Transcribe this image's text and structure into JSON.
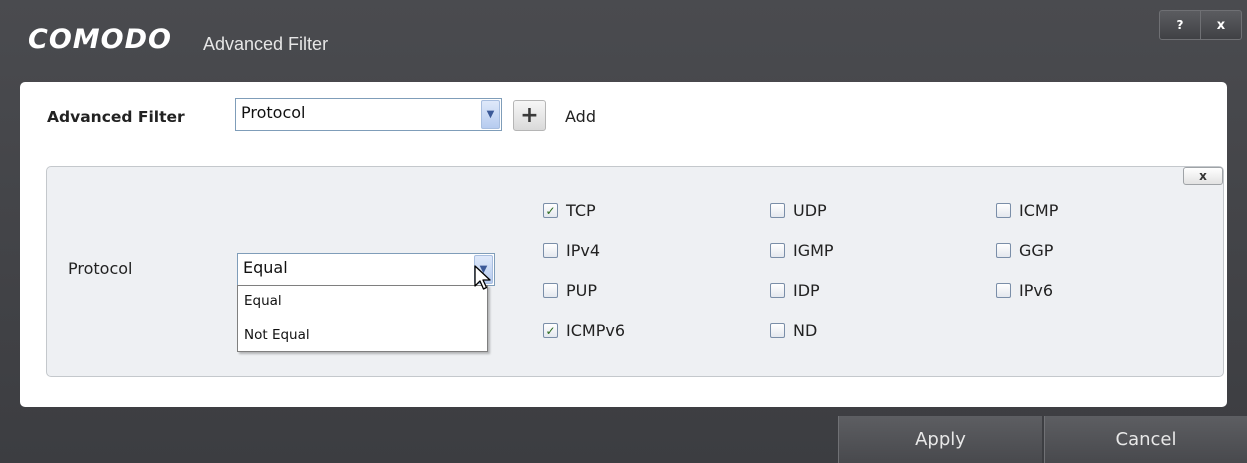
{
  "window": {
    "brand": "COMODO",
    "title": "Advanced Filter",
    "help_label": "?",
    "close_label": "x"
  },
  "filter": {
    "label": "Advanced Filter",
    "selected": "Protocol",
    "add_label": "Add"
  },
  "panel": {
    "remove_label": "x",
    "row_label": "Protocol",
    "operator": {
      "selected": "Equal",
      "options": [
        "Equal",
        "Not Equal"
      ]
    },
    "protocols": [
      {
        "label": "TCP",
        "checked": true
      },
      {
        "label": "UDP",
        "checked": false
      },
      {
        "label": "ICMP",
        "checked": false
      },
      {
        "label": "IPv4",
        "checked": false
      },
      {
        "label": "IGMP",
        "checked": false
      },
      {
        "label": "GGP",
        "checked": false
      },
      {
        "label": "PUP",
        "checked": false
      },
      {
        "label": "IDP",
        "checked": false
      },
      {
        "label": "IPv6",
        "checked": false
      },
      {
        "label": "ICMPv6",
        "checked": true
      },
      {
        "label": "ND",
        "checked": false
      }
    ]
  },
  "footer": {
    "apply_label": "Apply",
    "cancel_label": "Cancel"
  }
}
